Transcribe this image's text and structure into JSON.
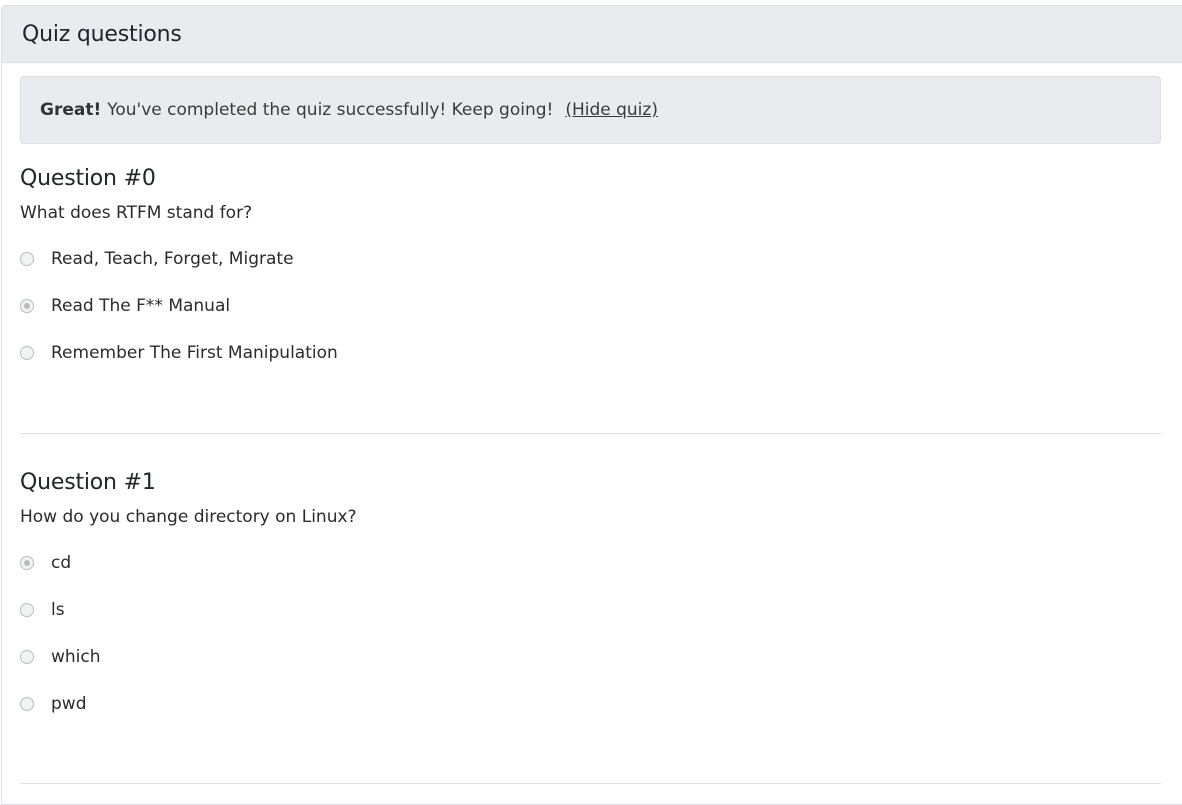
{
  "header": {
    "title": "Quiz questions"
  },
  "alert": {
    "strong": "Great!",
    "message": "You've completed the quiz successfully! Keep going!",
    "link": "(Hide quiz)"
  },
  "questions": [
    {
      "title": "Question #0",
      "text": "What does RTFM stand for?",
      "options": [
        {
          "label": "Read, Teach, Forget, Migrate",
          "checked": false
        },
        {
          "label": "Read The F** Manual",
          "checked": true
        },
        {
          "label": "Remember The First Manipulation",
          "checked": false
        }
      ]
    },
    {
      "title": "Question #1",
      "text": "How do you change directory on Linux?",
      "options": [
        {
          "label": "cd",
          "checked": true
        },
        {
          "label": "ls",
          "checked": false
        },
        {
          "label": "which",
          "checked": false
        },
        {
          "label": "pwd",
          "checked": false
        }
      ]
    }
  ]
}
